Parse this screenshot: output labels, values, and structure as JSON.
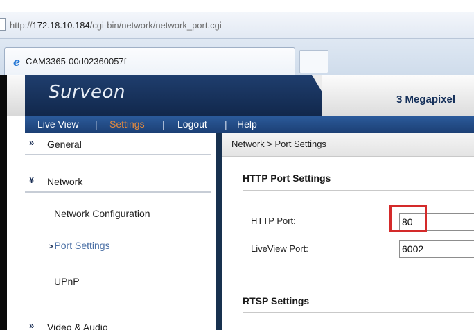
{
  "browser": {
    "url_prefix": "http://",
    "url_host": "172.18.10.184",
    "url_path": "/cgi-bin/network/network_port.cgi",
    "tab_title": "CAM3365-00d02360057f"
  },
  "header": {
    "logo": "Surveon",
    "product": "3 Megapixel"
  },
  "nav": {
    "live_view": "Live View",
    "sep": "|",
    "settings": "Settings",
    "logout": "Logout",
    "help": "Help"
  },
  "sidebar": {
    "general": {
      "chevron": "»",
      "label": "General"
    },
    "network": {
      "chevron": "¥",
      "label": "Network"
    },
    "items": [
      {
        "label": "Network Configuration"
      },
      {
        "label": "Port Settings",
        "arrow": ">"
      },
      {
        "label": "UPnP"
      }
    ],
    "video_audio": {
      "chevron": "»",
      "label": "Video & Audio"
    }
  },
  "content": {
    "breadcrumb": "Network > Port Settings",
    "http_section": "HTTP Port Settings",
    "http_port_label": "HTTP Port:",
    "http_port_value": "80",
    "liveview_port_label": "LiveView Port:",
    "liveview_port_value": "6002",
    "rtsp_section": "RTSP Settings"
  },
  "colors": {
    "nav_active": "#e58a3c",
    "highlight": "#d42a2a",
    "header_dark": "#1f3e6e"
  }
}
